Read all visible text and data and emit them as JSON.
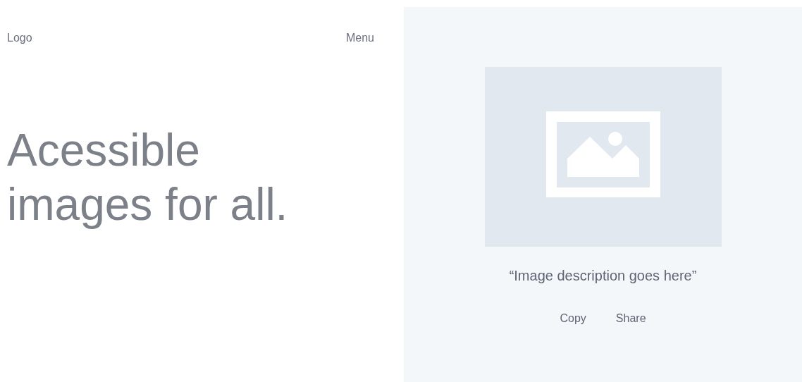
{
  "header": {
    "logo": "Logo",
    "menu": "Menu"
  },
  "headline": [
    "Acessible",
    "images for all."
  ],
  "preview": {
    "caption": "“Image description goes here”",
    "actions": [
      "Copy",
      "Share"
    ]
  }
}
